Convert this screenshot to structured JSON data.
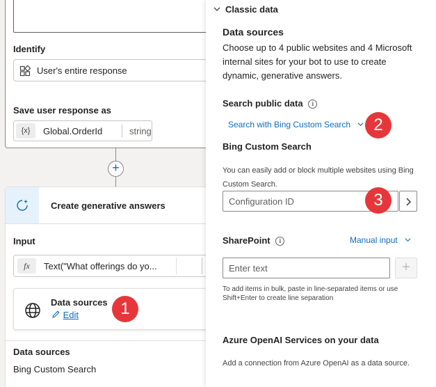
{
  "left": {
    "identify_label": "Identify",
    "identify_value": "User's entire response",
    "save_label": "Save user response as",
    "var_icon": "{x}",
    "var_name": "Global.OrderId",
    "var_type": "string",
    "add_icon": "+",
    "node_title": "Create generative answers",
    "input_label": "Input",
    "fx_icon": "fx",
    "input_value": "Text(\"What offerings do yo...",
    "ds_card_title": "Data sources",
    "ds_card_edit": "Edit",
    "ds_section_label": "Data sources",
    "ds_section_value": "Bing Custom Search"
  },
  "panel": {
    "classic_header": "Classic data",
    "ds_title": "Data sources",
    "ds_desc": "Choose up to 4 public websites and 4 Microsoft internal sites for your bot to use to create dynamic, generative answers.",
    "search_public_label": "Search public data",
    "info_glyph": "i",
    "search_dropdown": "Search with Bing Custom Search",
    "bing_title": "Bing Custom Search",
    "bing_desc": "You can easily add or block multiple websites using Bing Custom Search.",
    "config_placeholder": "Configuration ID",
    "sharepoint_label": "SharePoint",
    "manual_input": "Manual input",
    "enter_text_placeholder": "Enter text",
    "add_glyph": "+",
    "bulk_hint": "To add items in bulk, paste in line-separated items or use Shift+Enter to create line separation",
    "azure_title": "Azure OpenAI Services on your data",
    "azure_desc": "Add a connection from Azure OpenAI as a data source."
  },
  "badges": [
    "1",
    "2",
    "3"
  ],
  "colors": {
    "badge": "#e5373b",
    "link": "#0f6cbd",
    "accent_bg": "#e6f2fb"
  }
}
